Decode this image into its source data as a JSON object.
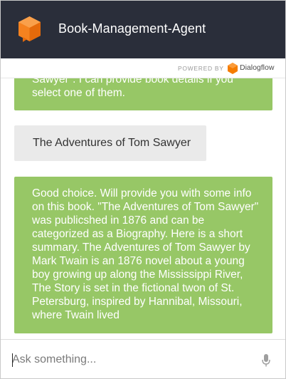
{
  "header": {
    "title": "Book-Management-Agent",
    "logo_icon": "dialogflow-agent-icon",
    "background": "#2a2e3a"
  },
  "powered_by": {
    "label": "POWERED BY",
    "brand": "Dialogflow"
  },
  "messages": [
    {
      "sender": "agent",
      "text": "Sawyer\". I can provide book details if you select one of them."
    },
    {
      "sender": "user",
      "text": "The Adventures of Tom Sawyer"
    },
    {
      "sender": "agent",
      "text": "Good choice. Will provide you with some info on this book. \"The Adventures of Tom Sawyer\" was publicshed in 1876 and can be categorized as a Biography. Here is a short summary. The Adventures of Tom Sawyer by Mark Twain is an 1876 novel about a young boy growing up along the Mississippi River, The Story is set in the fictional twon of St. Petersburg, inspired by Hannibal, Missouri, where Twain lived"
    }
  ],
  "input": {
    "placeholder": "Ask something...",
    "value": ""
  },
  "colors": {
    "agent_bubble": "#97c766",
    "user_bubble": "#eaeaea",
    "dialogflow_orange": "#f57c00"
  },
  "icons": {
    "mic": "microphone-icon"
  }
}
